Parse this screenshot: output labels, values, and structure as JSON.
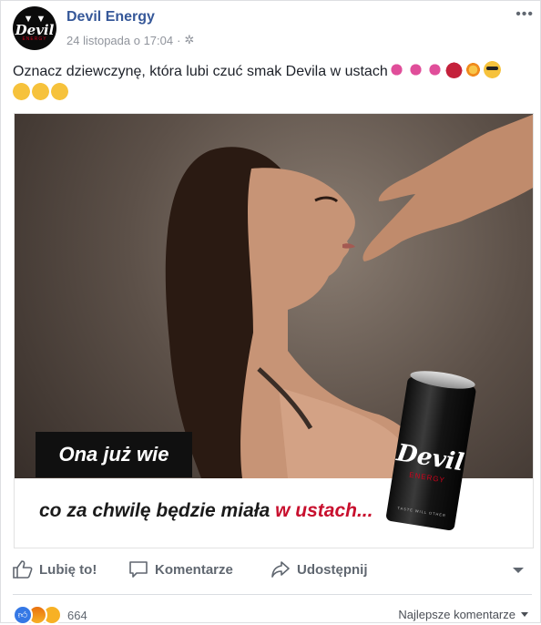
{
  "post": {
    "page_name": "Devil Energy",
    "timestamp": "24 listopada o 17:04",
    "separator": "·",
    "privacy_icon": "gear-icon",
    "more_icon": "more-options-icon",
    "avatar_text": "Devil",
    "avatar_sub": "ENERGY",
    "caption_text": "Oznacz dziewczynę, która lubi czuć smak Devila w ustach",
    "caption_emojis": [
      "kiss-mark",
      "kiss-mark",
      "kiss-mark",
      "devil",
      "sparkle",
      "sunglasses",
      "tongue-wink",
      "smile",
      "yum"
    ]
  },
  "image": {
    "headline": "Ona już wie",
    "subline_prefix": "co za chwilę będzie miała ",
    "subline_accent": "w ustach...",
    "can_brand": "Devil",
    "can_sub": "ENERGY",
    "can_tagline": "TASTE WILL OTHER",
    "accent_color": "#c8102e"
  },
  "actions": {
    "like_label": "Lubię to!",
    "comment_label": "Komentarze",
    "share_label": "Udostępnij"
  },
  "reactions": {
    "types": [
      "like",
      "angry",
      "haha"
    ],
    "count": "664",
    "sort_label": "Najlepsze komentarze"
  }
}
